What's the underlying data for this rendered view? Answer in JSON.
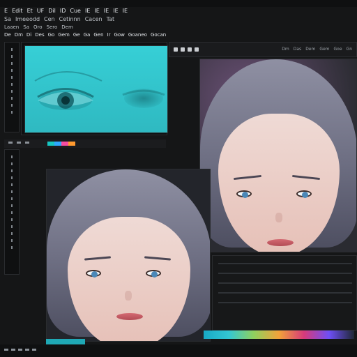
{
  "app": {
    "title_row": [
      "E",
      "Edit",
      "Et",
      "UF",
      "Dil",
      "ID",
      "Cue",
      "IE",
      "IE",
      "IE",
      "IE",
      "IE"
    ]
  },
  "menubar": {
    "items": [
      "Sa",
      "Imeeodd",
      "Cen",
      "Cetinnn",
      "Cacen",
      "Tat"
    ]
  },
  "submenu": {
    "items": [
      "Laaen",
      "Sa",
      "Oro",
      "Sero",
      "Dem"
    ]
  },
  "secondary_menu": {
    "items": [
      "De",
      "Dm",
      "Di",
      "Des",
      "Go",
      "Gem",
      "Ge",
      "Ga",
      "Gen",
      "Ir",
      "Gow",
      "Goaneo",
      "Gocan"
    ]
  },
  "left_panel": {
    "toolbar_swatches": [
      "#16c6c2",
      "#2ea7ff",
      "#f54da1",
      "#ff9a2f"
    ]
  },
  "viewer_top_right": {
    "toolbar_labels": [
      "Dm",
      "Das",
      "Dem",
      "Gem",
      "Goe",
      "Gn"
    ]
  },
  "bottom_status": {
    "left_color": "#1fa8b5",
    "gradient_colors": [
      "#18a9c6",
      "#33c6d3",
      "#8fd15e",
      "#f2a23a",
      "#d63a7a",
      "#6e4ff6",
      "#1f2833"
    ]
  },
  "colors": {
    "accent_cyan": "#3ed2da",
    "panel_bg": "#0f1011",
    "chrome_bg": "#1b1c1e"
  }
}
